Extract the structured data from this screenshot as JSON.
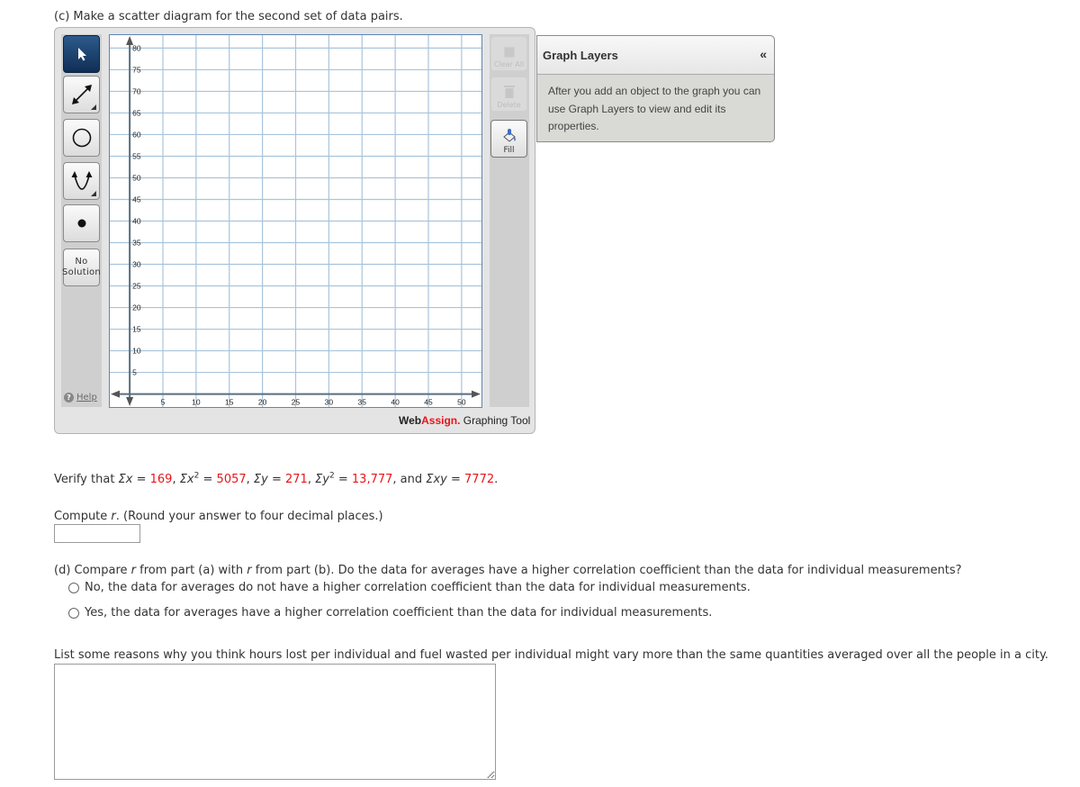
{
  "part_c": {
    "title": "(c) Make a scatter diagram for the second set of data pairs."
  },
  "graph_tool": {
    "tools": [
      {
        "name": "pointer",
        "icon": "cursor-arrow-icon",
        "active": true
      },
      {
        "name": "line",
        "icon": "double-arrow-line-icon",
        "active": false
      },
      {
        "name": "circle",
        "icon": "circle-icon",
        "active": false
      },
      {
        "name": "parabola",
        "icon": "parabola-icon",
        "active": false
      },
      {
        "name": "point",
        "icon": "point-icon",
        "active": false
      }
    ],
    "no_solution_line1": "No",
    "no_solution_line2": "Solution",
    "help_label": "Help",
    "clear_all_label": "Clear All",
    "delete_label": "Delete",
    "fill_label": "Fill",
    "brand_web": "Web",
    "brand_assign": "Assign.",
    "brand_suffix": " Graphing Tool",
    "axes": {
      "x_ticks": [
        5,
        10,
        15,
        20,
        25,
        30,
        35,
        40,
        45,
        50
      ],
      "y_ticks": [
        5,
        10,
        15,
        20,
        25,
        30,
        35,
        40,
        45,
        50,
        55,
        60,
        65,
        70,
        75,
        80
      ],
      "x_range": [
        -3,
        53
      ],
      "y_range": [
        -3,
        83
      ],
      "grid_step": 5
    },
    "colors": {
      "grid": "#a9c4db",
      "axis": "#5a6e80",
      "frame": "#5f86b3",
      "active_tool": "#1a3d6a",
      "brand_red": "#e8141a"
    }
  },
  "graph_layers": {
    "title": "Graph Layers",
    "collapse_icon": "«",
    "description": "After you add an object to the graph you can use Graph Layers to view and edit its properties."
  },
  "verify": {
    "prefix": "Verify that ",
    "sx_label": "Σx = ",
    "sx": "169",
    "sx2_label": "Σx",
    "sx2_eq": " = ",
    "sx2": "5057",
    "sy_label": "Σy = ",
    "sy": "271",
    "sy2_label": "Σy",
    "sy2_eq": " = ",
    "sy2": "13,777",
    "and": ", and ",
    "sxy_label": "Σxy = ",
    "sxy": "7772",
    "sep": ", ",
    "end": "."
  },
  "compute": {
    "prefix": "Compute ",
    "var": "r",
    "suffix": ". (Round your answer to four decimal places.)",
    "answer": ""
  },
  "part_d": {
    "p1": "(d) Compare ",
    "r1": "r",
    "p2": " from part (a) with ",
    "r2": "r",
    "p3": " from part (b). Do the data for averages have a higher correlation coefficient than the data for individual measurements?",
    "options": [
      "No, the data for averages do not have a higher correlation coefficient than the data for individual measurements.",
      "Yes, the data for averages have a higher correlation coefficient than the data for individual measurements."
    ]
  },
  "reasons": {
    "prompt": "List some reasons why you think hours lost per individual and fuel wasted per individual might vary more than the same quantities averaged over all the people in a city.",
    "answer": ""
  }
}
